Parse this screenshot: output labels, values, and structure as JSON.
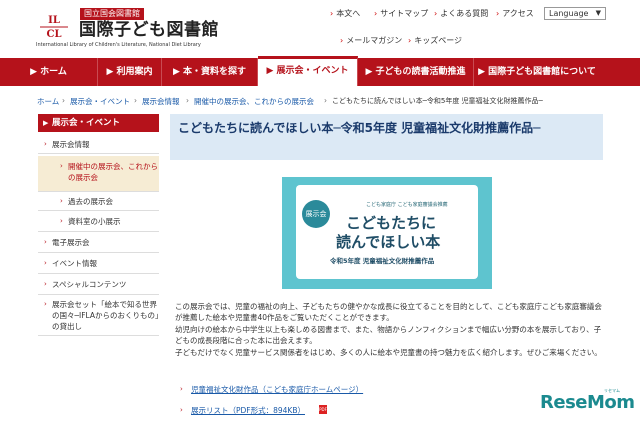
{
  "header": {
    "org": "国立国会図書館",
    "library": "国際子ども図書館",
    "library_en": "International Library of Children's Literature, National Diet Library"
  },
  "util_links": [
    "本文へ",
    "サイトマップ",
    "よくある質問",
    "アクセス",
    "メールマガジン",
    "キッズページ"
  ],
  "language": {
    "label": "Language"
  },
  "nav": [
    "ホーム",
    "利用案内",
    "本・資料を探す",
    "展示会・イベント",
    "子どもの読書活動推進",
    "国際子ども図書館について"
  ],
  "breadcrumb": [
    "ホーム",
    "展示会・イベント",
    "展示会情報",
    "開催中の展示会、これからの展示会",
    "こどもたちに読んでほしい本─令和5年度 児童福祉文化財推薦作品─"
  ],
  "sidebar": {
    "heading": "展示会・イベント",
    "items": [
      {
        "label": "展示会情報"
      },
      {
        "label": "開催中の展示会、これからの展示会"
      },
      {
        "label": "過去の展示会"
      },
      {
        "label": "資料室の小展示"
      },
      {
        "label": "電子展示会"
      },
      {
        "label": "イベント情報"
      },
      {
        "label": "スペシャルコンテンツ"
      },
      {
        "label": "展示会セット「絵本で知る世界の国々─IFLAからのおくりもの」の貸出し"
      }
    ]
  },
  "main": {
    "title": "こどもたちに読んでほしい本─令和5年度 児童福祉文化財推薦作品─",
    "banner": {
      "tag": "展示会",
      "sub": "こども家庭庁 こども家庭審議会推薦",
      "line1": "こどもたちに",
      "line2": "読んでほしい本",
      "footer": "令和5年度 児童福祉文化財推薦作品"
    },
    "paragraphs": [
      "この展示会では、児童の福祉の向上、子どもたちの健やかな成長に役立てることを目的として、こども家庭庁こども家庭審議会が推薦した絵本や児童書40作品をご覧いただくことができます。",
      "幼児向けの絵本から中学生以上も楽しめる図書まで、また、物語からノンフィクションまで幅広い分野の本を展示しており、子どもの成長段階に合った本に出会えます。",
      "子どもだけでなく児童サービス関係者をはじめ、多くの人に絵本や児童書の持つ魅力を広く紹介します。ぜひご来場ください。"
    ],
    "links": [
      "児童福祉文化財作品（こども家庭庁ホームページ）",
      "展示リスト（PDF形式：894KB）"
    ],
    "pdf_icon": "pdf-icon"
  },
  "watermark": {
    "brand": "ReseMom",
    "small": "リセマム"
  },
  "colors": {
    "accent": "#b5121b",
    "banner": "#5ec4cf",
    "title_bg": "#dce9f5"
  }
}
